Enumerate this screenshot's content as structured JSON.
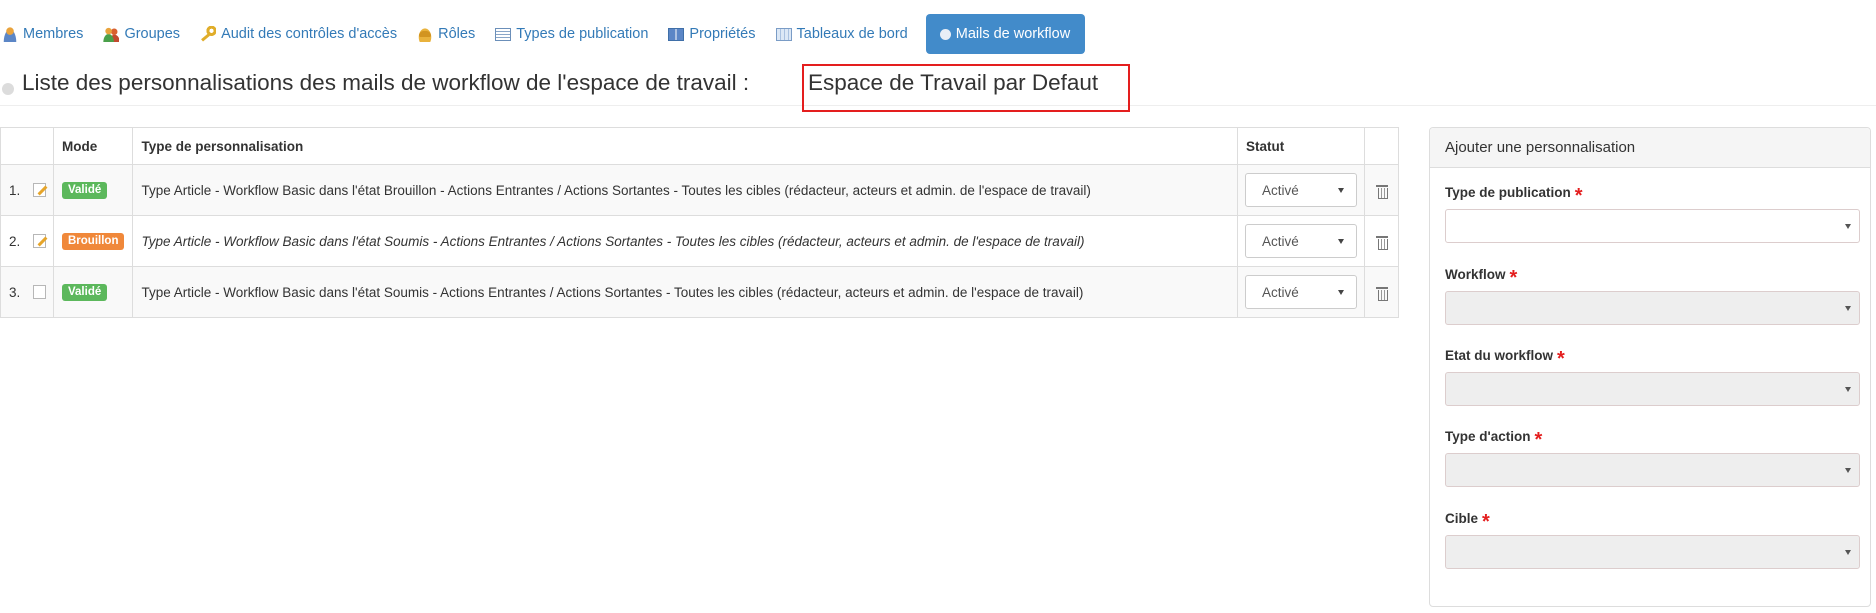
{
  "nav": {
    "items": [
      {
        "label": "Membres",
        "icon": "person-icon"
      },
      {
        "label": "Groupes",
        "icon": "group-icon"
      },
      {
        "label": "Audit des contrôles d'accès",
        "icon": "key-icon"
      },
      {
        "label": "Rôles",
        "icon": "hat-icon"
      },
      {
        "label": "Types de publication",
        "icon": "list-icon"
      },
      {
        "label": "Propriétés",
        "icon": "properties-icon"
      },
      {
        "label": "Tableaux de bord",
        "icon": "dashboard-icon"
      },
      {
        "label": "Mails de workflow",
        "icon": "mail-icon",
        "active": true
      }
    ]
  },
  "page": {
    "title": "Liste des personnalisations des mails de workflow de l'espace de travail :",
    "workspace": "Espace de Travail par Defaut"
  },
  "table": {
    "headers": {
      "mode": "Mode",
      "type": "Type de personnalisation",
      "status": "Statut"
    },
    "rows": [
      {
        "num": "1.",
        "mode": "Validé",
        "description": "Type Article - Workflow Basic dans l'état Brouillon - Actions Entrantes / Actions Sortantes - Toutes les cibles (rédacteur, acteurs et admin. de l'espace de travail)",
        "status": "Activé"
      },
      {
        "num": "2.",
        "mode": "Brouillon",
        "description": "Type Article - Workflow Basic dans l'état Soumis - Actions Entrantes / Actions Sortantes - Toutes les cibles (rédacteur, acteurs et admin. de l'espace de travail)",
        "status": "Activé"
      },
      {
        "num": "3.",
        "mode": "Validé",
        "description": "Type Article - Workflow Basic dans l'état Soumis - Actions Entrantes / Actions Sortantes - Toutes les cibles (rédacteur, acteurs et admin. de l'espace de travail)",
        "status": "Activé"
      }
    ]
  },
  "panel": {
    "title": "Ajouter une personnalisation",
    "required_mark": "*",
    "fields": [
      {
        "label": "Type de publication",
        "value": ""
      },
      {
        "label": "Workflow",
        "value": ""
      },
      {
        "label": "Etat du workflow",
        "value": ""
      },
      {
        "label": "Type d'action",
        "value": ""
      },
      {
        "label": "Cible",
        "value": ""
      }
    ]
  },
  "colors": {
    "link": "#337ab7",
    "active_tab": "#428bca",
    "badge_validated": "#5cb85c",
    "badge_draft": "#f0883a",
    "required": "#e41e1e",
    "highlight_border": "#e41e1e"
  }
}
